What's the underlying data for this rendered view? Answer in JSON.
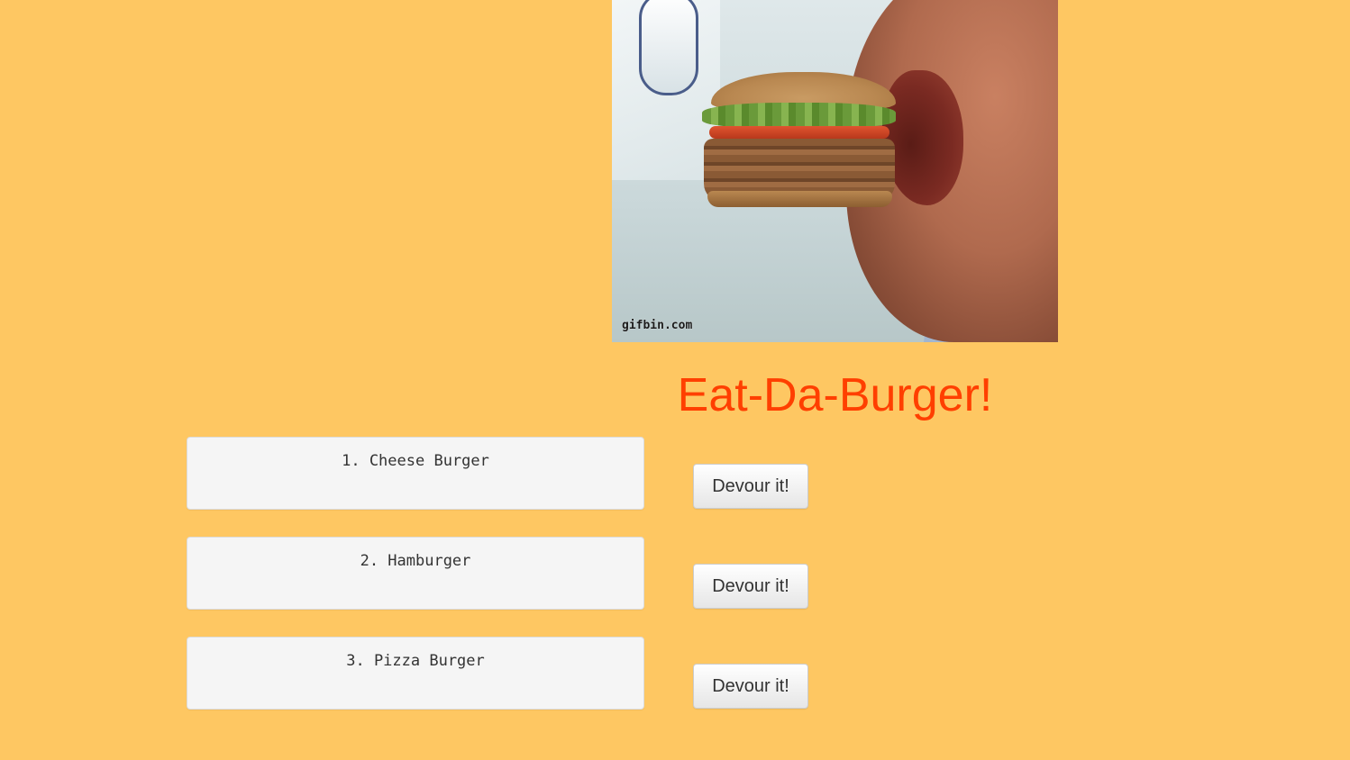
{
  "hero": {
    "caption": "gifbin.com"
  },
  "header": {
    "title": "Eat-Da-Burger!"
  },
  "burgers": [
    {
      "label": "1. Cheese Burger",
      "button": "Devour it!"
    },
    {
      "label": "2. Hamburger",
      "button": "Devour it!"
    },
    {
      "label": "3. Pizza Burger",
      "button": "Devour it!"
    }
  ],
  "colors": {
    "background": "#fec762",
    "title": "#ff3f00",
    "card": "#f5f5f5"
  }
}
